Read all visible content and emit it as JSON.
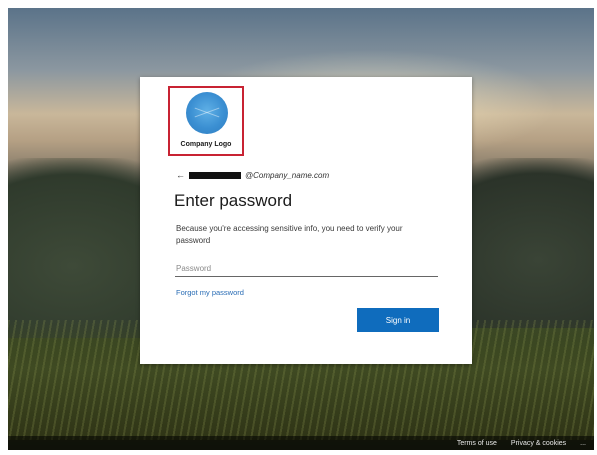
{
  "logo": {
    "text": "Company Logo"
  },
  "identity": {
    "back_icon": "←",
    "email_domain": "@Company_name.com"
  },
  "title": "Enter password",
  "description": "Because you're accessing sensitive info, you need to verify your password",
  "password": {
    "placeholder": "Password",
    "value": ""
  },
  "forgot_link": "Forgot my password",
  "signin_label": "Sign in",
  "footer": {
    "terms": "Terms of use",
    "privacy": "Privacy & cookies",
    "more": "..."
  },
  "colors": {
    "primary_button": "#0f6cbd",
    "link": "#2a6db5",
    "logo_highlight": "#c82333"
  }
}
